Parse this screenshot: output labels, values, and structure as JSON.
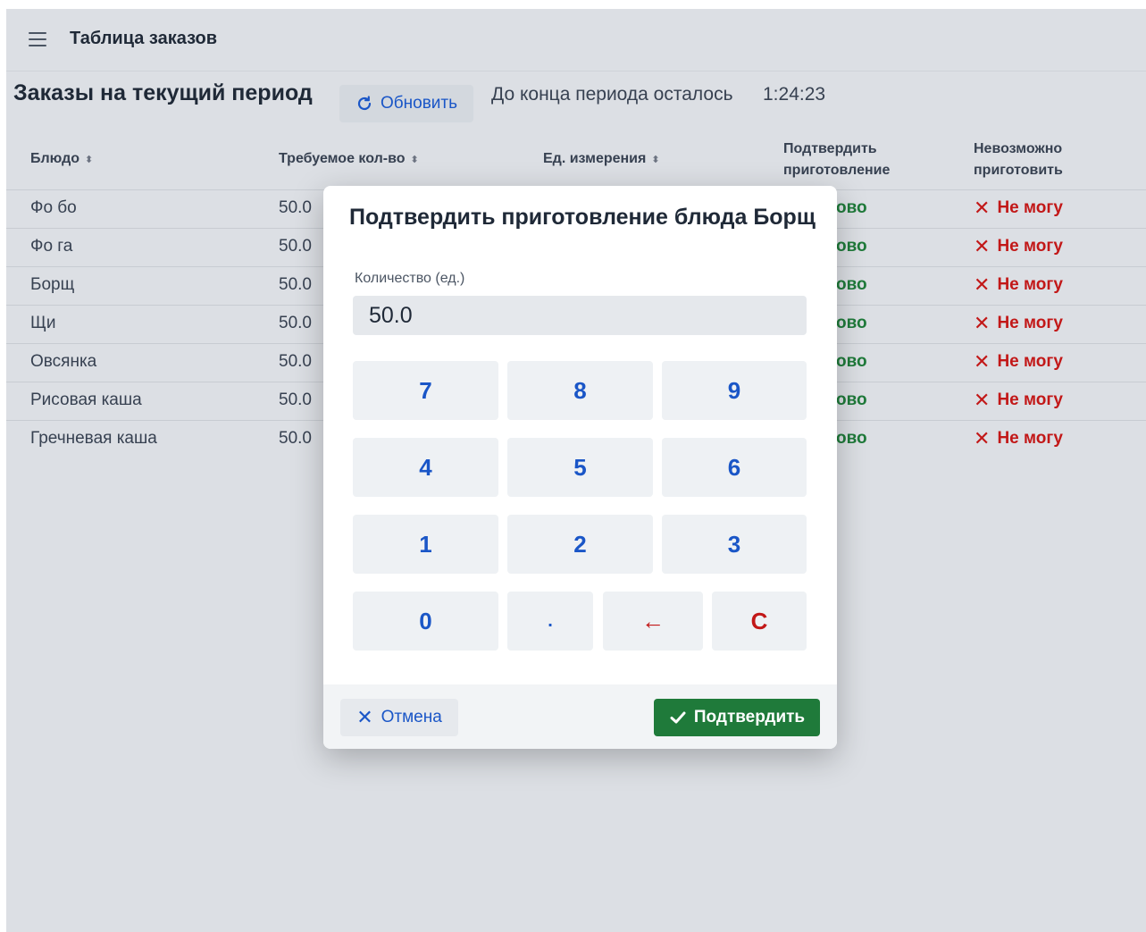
{
  "header": {
    "title": "Таблица заказов",
    "menu_icon": "hamburger-menu-icon"
  },
  "page": {
    "heading": "Заказы на текущий период",
    "refresh_label": "Обновить",
    "timer_label": "До конца периода осталось",
    "timer_value": "1:24:23"
  },
  "table": {
    "columns": {
      "dish": "Блюдо",
      "qty": "Требуемое кол-во",
      "unit": "Ед. измерения",
      "confirm_line1": "Подтвердить",
      "confirm_line2": "приготовление",
      "cant_line1": "Невозможно",
      "cant_line2": "приготовить",
      "sort_glyph": "⬍"
    },
    "rows": [
      {
        "dish": "Фо бо",
        "qty": "50.0",
        "ready": "ово",
        "cant": "Не могу"
      },
      {
        "dish": "Фо га",
        "qty": "50.0",
        "ready": "ово",
        "cant": "Не могу"
      },
      {
        "dish": "Борщ",
        "qty": "50.0",
        "ready": "ово",
        "cant": "Не могу"
      },
      {
        "dish": "Щи",
        "qty": "50.0",
        "ready": "ово",
        "cant": "Не могу"
      },
      {
        "dish": "Овсянка",
        "qty": "50.0",
        "ready": "ово",
        "cant": "Не могу"
      },
      {
        "dish": "Рисовая каша",
        "qty": "50.0",
        "ready": "ово",
        "cant": "Не могу"
      },
      {
        "dish": "Гречневая каша",
        "qty": "50.0",
        "ready": "ово",
        "cant": "Не могу"
      }
    ]
  },
  "dialog": {
    "title": "Подтвердить приготовление блюда Борщ",
    "qty_label": "Количество (ед.)",
    "qty_value": "50.0",
    "keys": [
      "7",
      "8",
      "9",
      "4",
      "5",
      "6",
      "1",
      "2",
      "3",
      "0",
      ".",
      "←",
      "C"
    ],
    "cancel_label": "Отмена",
    "confirm_label": "Подтвердить"
  },
  "colors": {
    "accent": "#1a56c7",
    "success": "#1f7a3a",
    "danger": "#c21818",
    "background": "#dcdfe4"
  }
}
